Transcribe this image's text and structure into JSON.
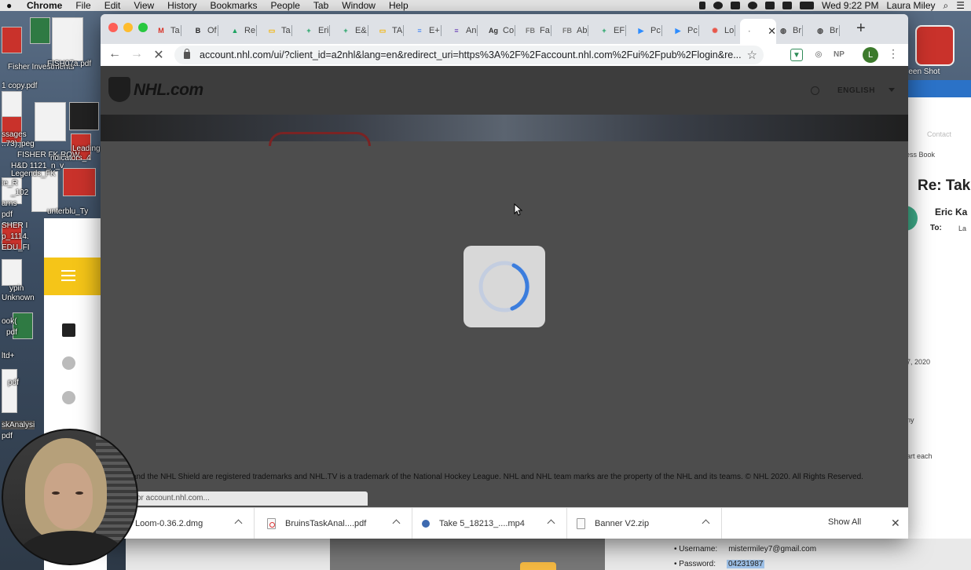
{
  "menubar": {
    "app_name": "Chrome",
    "menus": [
      "File",
      "Edit",
      "View",
      "History",
      "Bookmarks",
      "People",
      "Tab",
      "Window",
      "Help"
    ],
    "clock": "Wed 9:22 PM",
    "user": "Laura Miley"
  },
  "desktop": {
    "labels": [
      "Fisher Investments",
      "FISH07a.pdf",
      "1 copy.pdf",
      "ssages",
      "..73).jpeg",
      "FISHER FK ROW",
      "Leading",
      "ndicators_4",
      "H&D 1121_n_v",
      "Legends_FK",
      "ie_R",
      "_102",
      "arns",
      "pdf",
      "unterblu_Ty",
      "SHER I",
      "p_1114.",
      "EDU_FI",
      "ypin",
      "Unknown",
      "ook(",
      "pdf",
      "ltd+",
      "pdf",
      "skAnalysi",
      "pdf"
    ],
    "screenshot_label": "reen Shot"
  },
  "mail_app": {
    "title": "Re: Take",
    "sender": "Eric Ka",
    "to_label": "To:",
    "to_value": "La",
    "contact_label": "Contact",
    "address_book": "ress Book",
    "date": "7, 2020",
    "snippet1": "ny",
    "snippet2": "art each"
  },
  "credentials": {
    "username_label": "Username:",
    "username_value": "mistermiley7@gmail.com",
    "password_label": "Password:",
    "password_value": "04231987"
  },
  "chrome": {
    "tabs": [
      {
        "label": "Ta",
        "icon": "gmail-icon",
        "color": "#d93025",
        "glyph": "M"
      },
      {
        "label": "Of",
        "icon": "bruins-icon",
        "color": "#222222",
        "glyph": "B"
      },
      {
        "label": "Re",
        "icon": "drive-icon",
        "color": "#1fa463",
        "glyph": "▲"
      },
      {
        "label": "Ta",
        "icon": "slides-icon",
        "color": "#f4b400",
        "glyph": "▭"
      },
      {
        "label": "Eri",
        "icon": "sheets-icon",
        "color": "#0f9d58",
        "glyph": "+"
      },
      {
        "label": "E&",
        "icon": "sheets-icon",
        "color": "#0f9d58",
        "glyph": "+"
      },
      {
        "label": "TA",
        "icon": "slides-icon",
        "color": "#f4b400",
        "glyph": "▭"
      },
      {
        "label": "E+",
        "icon": "docs-icon",
        "color": "#4285f4",
        "glyph": "≡"
      },
      {
        "label": "An",
        "icon": "forms-icon",
        "color": "#673ab7",
        "glyph": "≡"
      },
      {
        "label": "Co",
        "icon": "adage-icon",
        "color": "#333333",
        "glyph": "Ag"
      },
      {
        "label": "Fa",
        "icon": "fb-icon",
        "color": "#777777",
        "glyph": "FB"
      },
      {
        "label": "Ab",
        "icon": "fb-icon",
        "color": "#777777",
        "glyph": "FB"
      },
      {
        "label": "EF",
        "icon": "sheets-icon",
        "color": "#0f9d58",
        "glyph": "+"
      },
      {
        "label": "Pc",
        "icon": "zoom-icon",
        "color": "#2d8cff",
        "glyph": "▶"
      },
      {
        "label": "Pc",
        "icon": "zoom-icon",
        "color": "#2d8cff",
        "glyph": "▶"
      },
      {
        "label": "Lo",
        "icon": "loom-icon",
        "color": "#e8574a",
        "glyph": "✺"
      },
      {
        "label": "",
        "icon": "loading-icon",
        "color": "#888888",
        "glyph": "·",
        "active": true
      },
      {
        "label": "Br",
        "icon": "globe-icon",
        "color": "#444444",
        "glyph": "◍"
      },
      {
        "label": "Br",
        "icon": "globe-icon",
        "color": "#444444",
        "glyph": "◍"
      }
    ],
    "new_tab_glyph": "+",
    "url": "account.nhl.com/ui/?client_id=a2nhl&lang=en&redirect_uri=https%3A%2F%2Faccount.nhl.com%2Fui%2Fpub%2Flogin&re...",
    "extensions": [
      {
        "icon": "save-extension-icon",
        "glyph": "▼",
        "color": "#2e8b57"
      },
      {
        "icon": "search-extension-icon",
        "glyph": "◎",
        "color": "#555555"
      },
      {
        "icon": "np-extension-icon",
        "glyph": "NP",
        "color": "#777777"
      }
    ],
    "profile_initial": "L"
  },
  "page": {
    "logo_text": "NHL.com",
    "language": "ENGLISH",
    "footer": "and the NHL Shield are registered trademarks and NHL.TV is a trademark of the National Hockey League. NHL and NHL team marks are the property of the NHL and its teams. © NHL 2020. All Rights Reserved.",
    "status_text": "or account.nhl.com..."
  },
  "downloads": {
    "items": [
      {
        "name": "Loom-0.36.2.dmg",
        "icon": "dmg-file-icon"
      },
      {
        "name": "BruinsTaskAnal....pdf",
        "icon": "pdf-file-icon"
      },
      {
        "name": "Take 5_18213_....mp4",
        "icon": "video-file-icon"
      },
      {
        "name": "Banner V2.zip",
        "icon": "zip-file-icon"
      }
    ],
    "show_all": "Show All",
    "close_glyph": "✕"
  }
}
